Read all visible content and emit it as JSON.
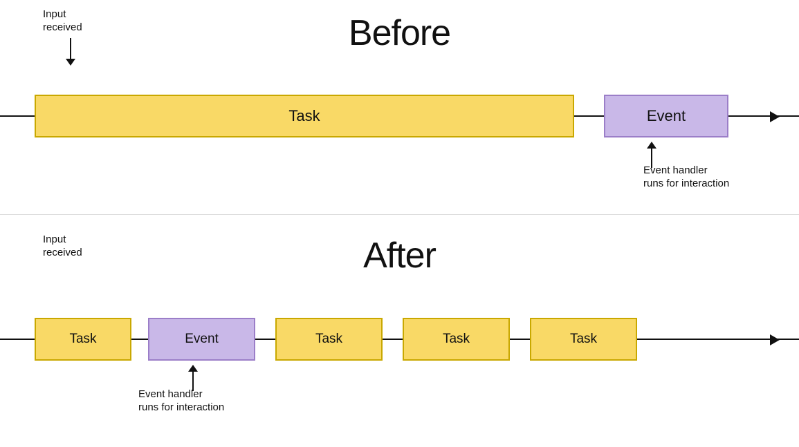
{
  "before": {
    "title": "Before",
    "input_label": "Input\nreceived",
    "task_label": "Task",
    "event_label": "Event",
    "event_handler_label": "Event handler\nruns for interaction"
  },
  "after": {
    "title": "After",
    "input_label": "Input\nreceived",
    "task_label": "Task",
    "event_label": "Event",
    "task2_label": "Task",
    "task3_label": "Task",
    "task4_label": "Task",
    "event_handler_label": "Event handler\nruns for interaction"
  }
}
